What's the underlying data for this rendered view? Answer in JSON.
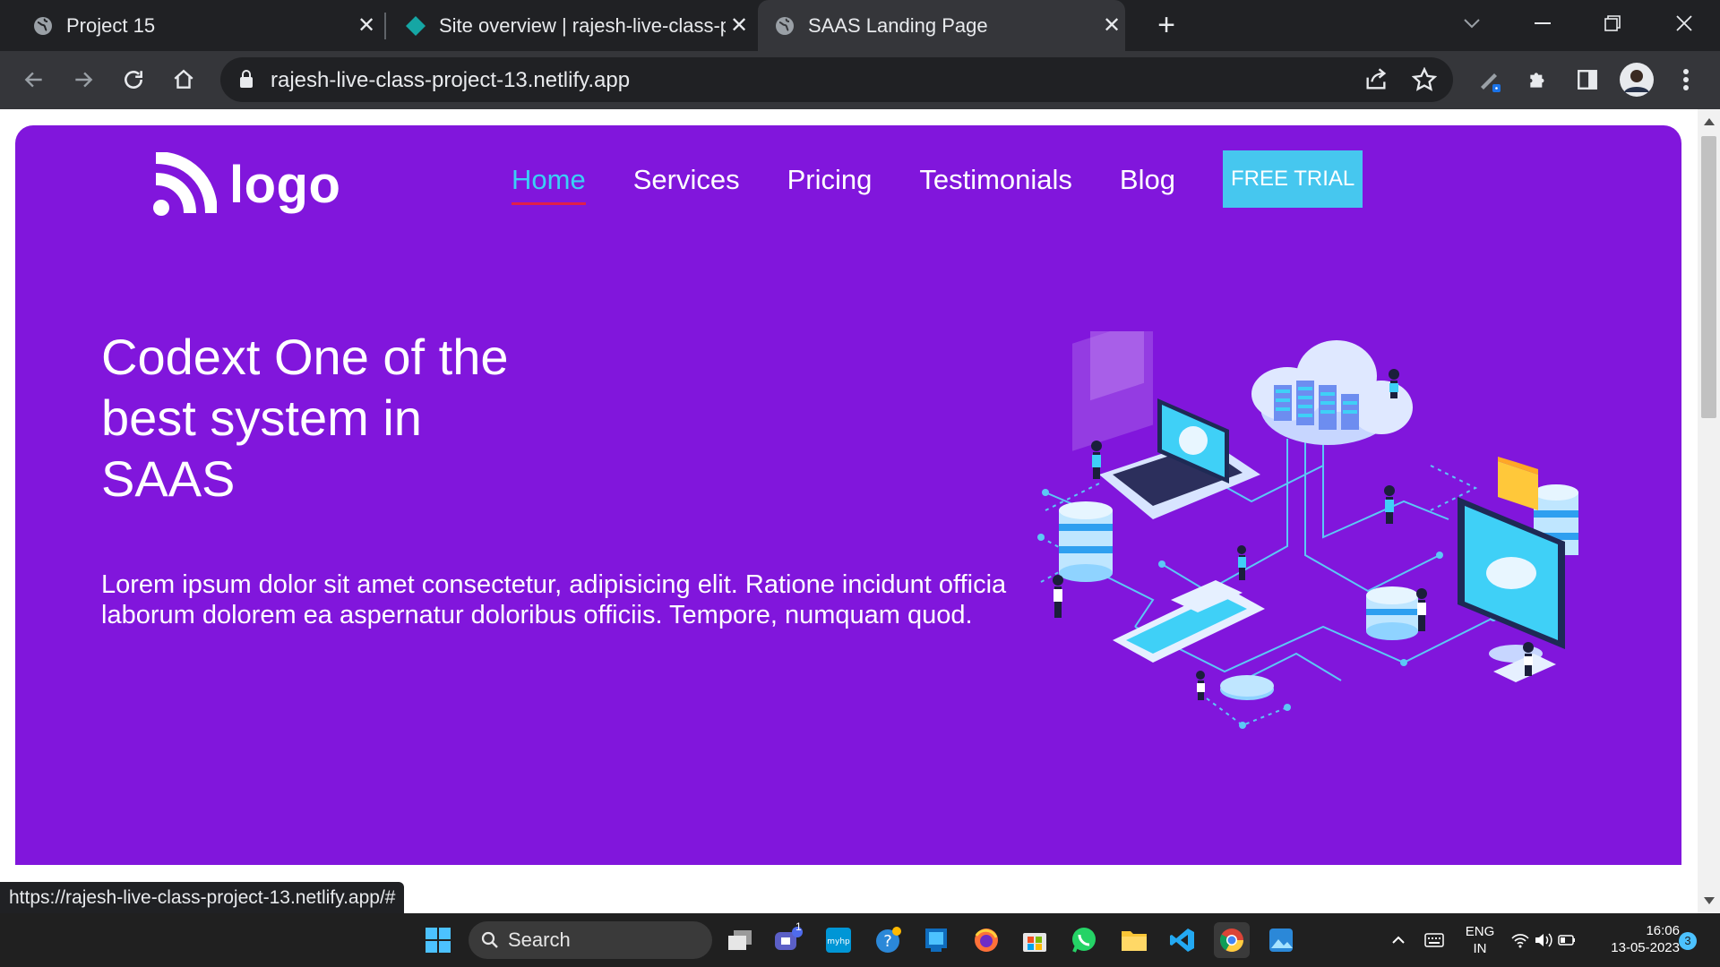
{
  "browser": {
    "tabs": [
      {
        "title": "Project 15",
        "active": false,
        "icon": "globe-icon"
      },
      {
        "title": "Site overview | rajesh-live-class-p",
        "active": false,
        "icon": "netlify-icon"
      },
      {
        "title": "SAAS Landing Page",
        "active": true,
        "icon": "globe-icon"
      }
    ],
    "url": "rajesh-live-class-project-13.netlify.app",
    "status_url": "https://rajesh-live-class-project-13.netlify.app/#"
  },
  "page": {
    "logo_text": "logo",
    "nav": [
      {
        "label": "Home",
        "active": true
      },
      {
        "label": "Services",
        "active": false
      },
      {
        "label": "Pricing",
        "active": false
      },
      {
        "label": "Testimonials",
        "active": false
      },
      {
        "label": "Blog",
        "active": false
      }
    ],
    "cta_label": "FREE TRIAL",
    "headline": "Codext One of the best system in SAAS",
    "description": "Lorem ipsum dolor sit amet consectetur, adipisicing elit. Ratione incidunt officia laborum dolorem ea aspernatur doloribus officiis. Tempore, numquam quod.",
    "colors": {
      "hero_bg": "#8116dc",
      "accent": "#3ad0f5",
      "cta_bg": "#46c7ef",
      "underline": "#e0204a"
    }
  },
  "taskbar": {
    "search_label": "Search",
    "language_top": "ENG",
    "language_bottom": "IN",
    "time": "16:06",
    "date": "13-05-2023",
    "notification_count": "3",
    "teams_badge": "1"
  }
}
